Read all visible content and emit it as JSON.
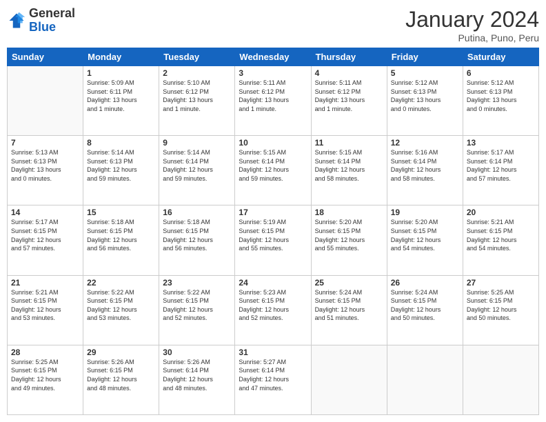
{
  "header": {
    "logo": {
      "general": "General",
      "blue": "Blue"
    },
    "title": "January 2024",
    "subtitle": "Putina, Puno, Peru"
  },
  "weekdays": [
    "Sunday",
    "Monday",
    "Tuesday",
    "Wednesday",
    "Thursday",
    "Friday",
    "Saturday"
  ],
  "weeks": [
    [
      {
        "day": "",
        "info": ""
      },
      {
        "day": "1",
        "info": "Sunrise: 5:09 AM\nSunset: 6:11 PM\nDaylight: 13 hours\nand 1 minute."
      },
      {
        "day": "2",
        "info": "Sunrise: 5:10 AM\nSunset: 6:12 PM\nDaylight: 13 hours\nand 1 minute."
      },
      {
        "day": "3",
        "info": "Sunrise: 5:11 AM\nSunset: 6:12 PM\nDaylight: 13 hours\nand 1 minute."
      },
      {
        "day": "4",
        "info": "Sunrise: 5:11 AM\nSunset: 6:12 PM\nDaylight: 13 hours\nand 1 minute."
      },
      {
        "day": "5",
        "info": "Sunrise: 5:12 AM\nSunset: 6:13 PM\nDaylight: 13 hours\nand 0 minutes."
      },
      {
        "day": "6",
        "info": "Sunrise: 5:12 AM\nSunset: 6:13 PM\nDaylight: 13 hours\nand 0 minutes."
      }
    ],
    [
      {
        "day": "7",
        "info": "Sunrise: 5:13 AM\nSunset: 6:13 PM\nDaylight: 13 hours\nand 0 minutes."
      },
      {
        "day": "8",
        "info": "Sunrise: 5:14 AM\nSunset: 6:13 PM\nDaylight: 12 hours\nand 59 minutes."
      },
      {
        "day": "9",
        "info": "Sunrise: 5:14 AM\nSunset: 6:14 PM\nDaylight: 12 hours\nand 59 minutes."
      },
      {
        "day": "10",
        "info": "Sunrise: 5:15 AM\nSunset: 6:14 PM\nDaylight: 12 hours\nand 59 minutes."
      },
      {
        "day": "11",
        "info": "Sunrise: 5:15 AM\nSunset: 6:14 PM\nDaylight: 12 hours\nand 58 minutes."
      },
      {
        "day": "12",
        "info": "Sunrise: 5:16 AM\nSunset: 6:14 PM\nDaylight: 12 hours\nand 58 minutes."
      },
      {
        "day": "13",
        "info": "Sunrise: 5:17 AM\nSunset: 6:14 PM\nDaylight: 12 hours\nand 57 minutes."
      }
    ],
    [
      {
        "day": "14",
        "info": "Sunrise: 5:17 AM\nSunset: 6:15 PM\nDaylight: 12 hours\nand 57 minutes."
      },
      {
        "day": "15",
        "info": "Sunrise: 5:18 AM\nSunset: 6:15 PM\nDaylight: 12 hours\nand 56 minutes."
      },
      {
        "day": "16",
        "info": "Sunrise: 5:18 AM\nSunset: 6:15 PM\nDaylight: 12 hours\nand 56 minutes."
      },
      {
        "day": "17",
        "info": "Sunrise: 5:19 AM\nSunset: 6:15 PM\nDaylight: 12 hours\nand 55 minutes."
      },
      {
        "day": "18",
        "info": "Sunrise: 5:20 AM\nSunset: 6:15 PM\nDaylight: 12 hours\nand 55 minutes."
      },
      {
        "day": "19",
        "info": "Sunrise: 5:20 AM\nSunset: 6:15 PM\nDaylight: 12 hours\nand 54 minutes."
      },
      {
        "day": "20",
        "info": "Sunrise: 5:21 AM\nSunset: 6:15 PM\nDaylight: 12 hours\nand 54 minutes."
      }
    ],
    [
      {
        "day": "21",
        "info": "Sunrise: 5:21 AM\nSunset: 6:15 PM\nDaylight: 12 hours\nand 53 minutes."
      },
      {
        "day": "22",
        "info": "Sunrise: 5:22 AM\nSunset: 6:15 PM\nDaylight: 12 hours\nand 53 minutes."
      },
      {
        "day": "23",
        "info": "Sunrise: 5:22 AM\nSunset: 6:15 PM\nDaylight: 12 hours\nand 52 minutes."
      },
      {
        "day": "24",
        "info": "Sunrise: 5:23 AM\nSunset: 6:15 PM\nDaylight: 12 hours\nand 52 minutes."
      },
      {
        "day": "25",
        "info": "Sunrise: 5:24 AM\nSunset: 6:15 PM\nDaylight: 12 hours\nand 51 minutes."
      },
      {
        "day": "26",
        "info": "Sunrise: 5:24 AM\nSunset: 6:15 PM\nDaylight: 12 hours\nand 50 minutes."
      },
      {
        "day": "27",
        "info": "Sunrise: 5:25 AM\nSunset: 6:15 PM\nDaylight: 12 hours\nand 50 minutes."
      }
    ],
    [
      {
        "day": "28",
        "info": "Sunrise: 5:25 AM\nSunset: 6:15 PM\nDaylight: 12 hours\nand 49 minutes."
      },
      {
        "day": "29",
        "info": "Sunrise: 5:26 AM\nSunset: 6:15 PM\nDaylight: 12 hours\nand 48 minutes."
      },
      {
        "day": "30",
        "info": "Sunrise: 5:26 AM\nSunset: 6:14 PM\nDaylight: 12 hours\nand 48 minutes."
      },
      {
        "day": "31",
        "info": "Sunrise: 5:27 AM\nSunset: 6:14 PM\nDaylight: 12 hours\nand 47 minutes."
      },
      {
        "day": "",
        "info": ""
      },
      {
        "day": "",
        "info": ""
      },
      {
        "day": "",
        "info": ""
      }
    ]
  ]
}
